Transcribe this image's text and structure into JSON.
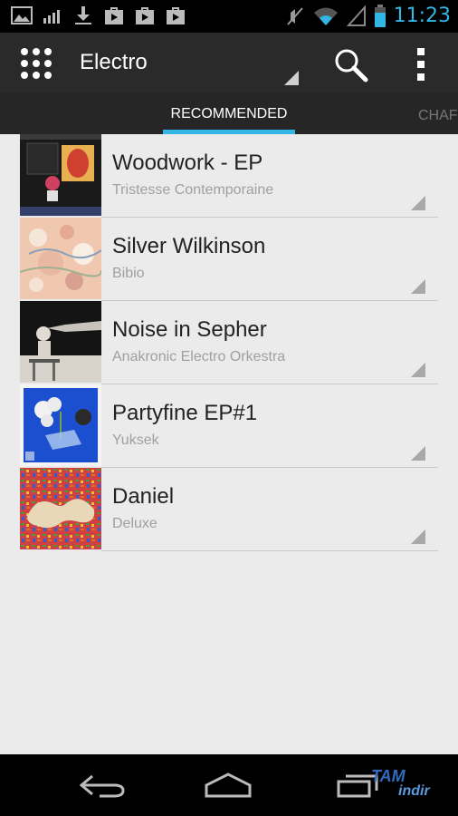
{
  "status_bar": {
    "time": "11:23",
    "clock_color": "#33b5e5",
    "left_icons": [
      "gallery-icon",
      "signal-bars-icon",
      "download-icon",
      "play-store-icon",
      "play-store-icon",
      "play-store-icon"
    ],
    "right_icons": [
      "muted-icon",
      "wifi-icon",
      "cell-signal-icon",
      "battery-icon"
    ]
  },
  "action_bar": {
    "title": "Electro",
    "apps_icon": "grid-apps-icon",
    "search_icon": "search-icon",
    "overflow_icon": "overflow-menu-icon"
  },
  "tabs": {
    "items": [
      {
        "label": "RECOMMENDED",
        "active": true
      },
      {
        "label": "CHAF",
        "active": false
      }
    ],
    "indicator_color": "#33b5e5"
  },
  "albums": [
    {
      "title": "Woodwork - EP",
      "artist": "Tristesse Contemporaine"
    },
    {
      "title": "Silver Wilkinson",
      "artist": "Bibio"
    },
    {
      "title": "Noise in Sepher",
      "artist": "Anakronic Electro Orkestra"
    },
    {
      "title": "Partyfine EP#1",
      "artist": "Yuksek"
    },
    {
      "title": "Daniel",
      "artist": "Deluxe"
    }
  ],
  "nav_bar": {
    "buttons": [
      "back-icon",
      "home-icon",
      "recent-apps-icon"
    ]
  },
  "watermark": {
    "line1": "TAM",
    "line2": "indir"
  }
}
